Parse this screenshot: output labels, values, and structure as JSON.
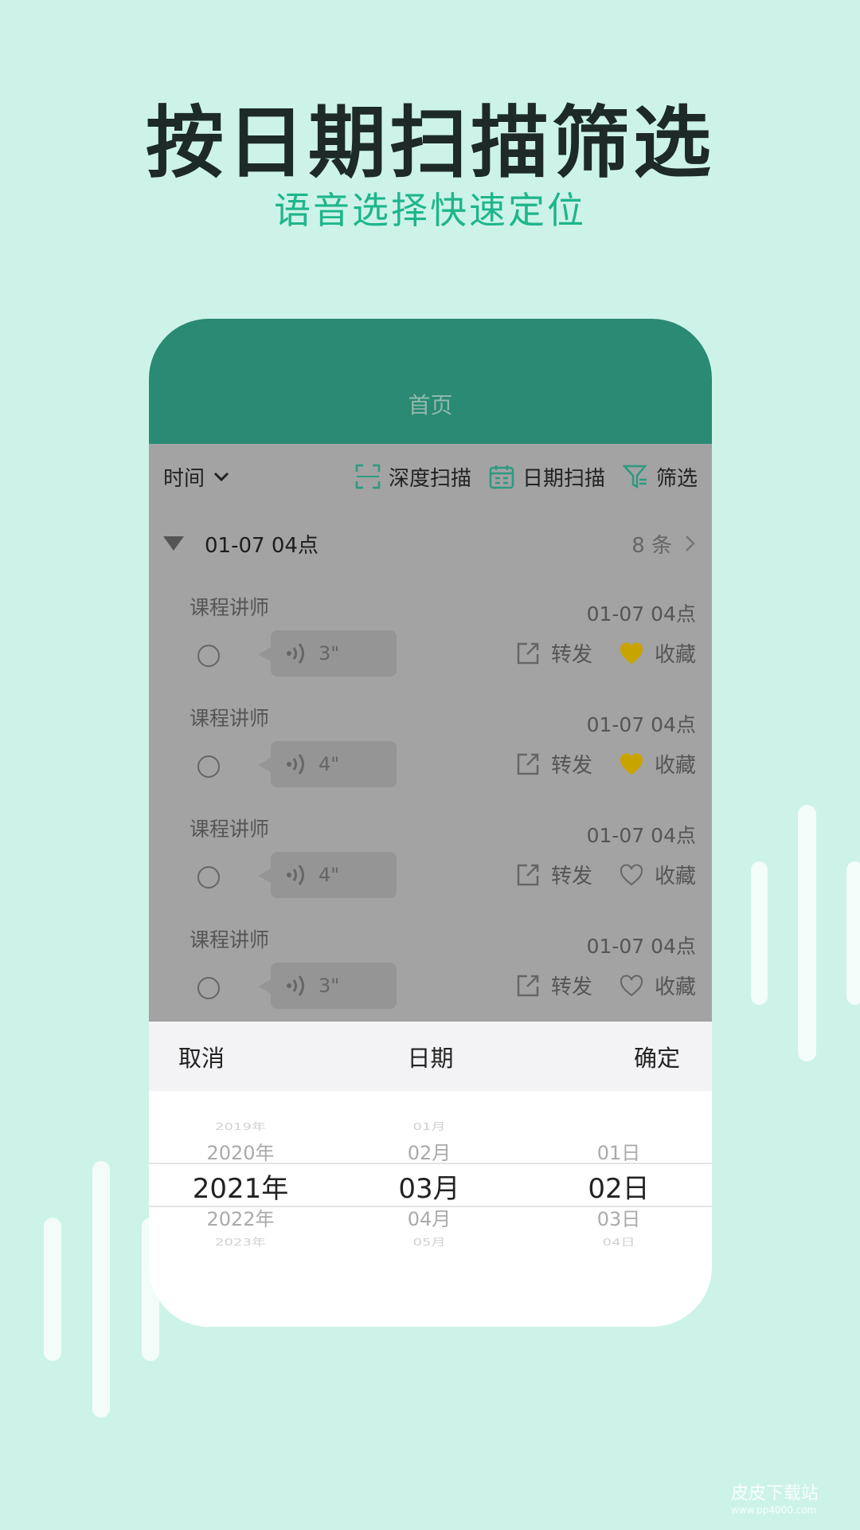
{
  "promo": {
    "title": "按日期扫描筛选",
    "subtitle": "语音选择快速定位"
  },
  "header": {
    "title": "首页"
  },
  "toolbar": {
    "sort_label": "时间",
    "deep_scan": "深度扫描",
    "date_scan": "日期扫描",
    "filter": "筛选"
  },
  "group": {
    "title": "01-07 04点",
    "count": "8 条"
  },
  "items": [
    {
      "label": "课程讲师",
      "time": "01-07 04点",
      "duration": "3\"",
      "forward": "转发",
      "favorite": "收藏",
      "favorited": true
    },
    {
      "label": "课程讲师",
      "time": "01-07 04点",
      "duration": "4\"",
      "forward": "转发",
      "favorite": "收藏",
      "favorited": true
    },
    {
      "label": "课程讲师",
      "time": "01-07 04点",
      "duration": "4\"",
      "forward": "转发",
      "favorite": "收藏",
      "favorited": false
    },
    {
      "label": "课程讲师",
      "time": "01-07 04点",
      "duration": "3\"",
      "forward": "转发",
      "favorite": "收藏",
      "favorited": false
    }
  ],
  "picker": {
    "cancel": "取消",
    "title": "日期",
    "confirm": "确定",
    "years": [
      "2019年",
      "2020年",
      "2021年",
      "2022年",
      "2023年"
    ],
    "months": [
      "01月",
      "02月",
      "03月",
      "04月",
      "05月"
    ],
    "days": [
      "",
      "01日",
      "02日",
      "03日",
      "04日"
    ],
    "selected": {
      "year": "2021年",
      "month": "03月",
      "day": "02日"
    }
  },
  "watermark": {
    "name": "皮皮下载站",
    "url": "www.pp4000.com"
  },
  "colors": {
    "background": "#cdf3e8",
    "header": "#2a8a73",
    "accent": "#1fb58c",
    "favorite": "#c9a400"
  }
}
